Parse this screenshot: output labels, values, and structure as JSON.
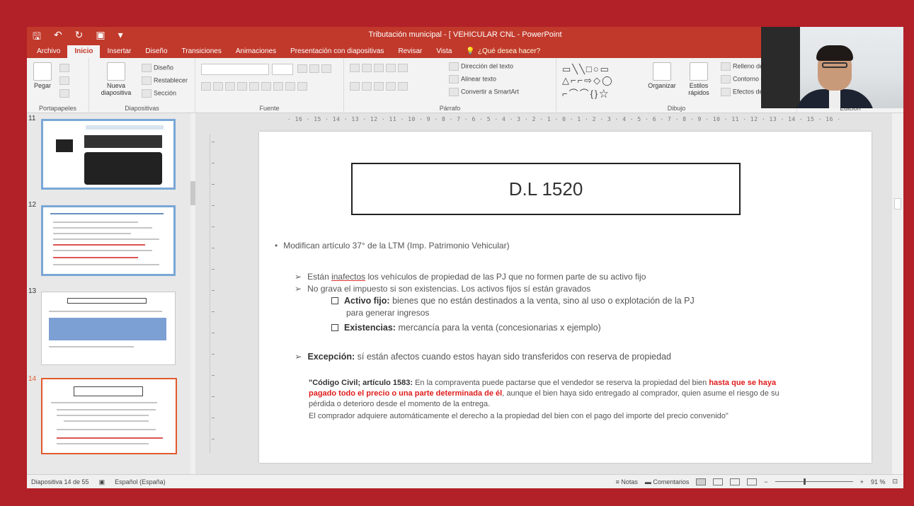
{
  "window": {
    "title": "Tributación municipal - [ VEHICULAR CNL - PowerPoint",
    "qat_icons": [
      "save-icon",
      "undo-icon",
      "redo-icon",
      "start-from-beginning-icon",
      "customize-icon"
    ]
  },
  "ribbon": {
    "tabs": [
      "Archivo",
      "Inicio",
      "Insertar",
      "Diseño",
      "Transiciones",
      "Animaciones",
      "Presentación con diapositivas",
      "Revisar",
      "Vista"
    ],
    "active_tab": "Inicio",
    "tell_me": "¿Qué desea hacer?",
    "groups": {
      "clipboard": {
        "name": "Portapapeles",
        "paste": "Pegar"
      },
      "slides": {
        "name": "Diapositivas",
        "new_slide": "Nueva diapositiva",
        "layout": "Diseño",
        "reset": "Restablecer",
        "section": "Sección"
      },
      "font": {
        "name": "Fuente"
      },
      "paragraph": {
        "name": "Párrafo",
        "text_direction": "Dirección del texto",
        "align_text": "Alinear texto",
        "convert_smartart": "Convertir a SmartArt"
      },
      "drawing": {
        "name": "Dibujo",
        "arrange": "Organizar",
        "quick_styles": "Estilos rápidos",
        "shape_fill": "Relleno de forma",
        "shape_outline": "Contorno de forma",
        "shape_effects": "Efectos de forma"
      },
      "editing": {
        "name": "Edición"
      }
    }
  },
  "thumbnails": [
    {
      "number": "11"
    },
    {
      "number": "12"
    },
    {
      "number": "13"
    },
    {
      "number": "14"
    }
  ],
  "ruler": "· 16 · 15 · 14 · 13 · 12 · 11 · 10 · 9 · 8 · 7 · 6 · 5 · 4 · 3 · 2 · 1 · 0 · 1 · 2 · 3 · 4 · 5 · 6 · 7 · 8 · 9 · 10 · 11 · 12 · 13 · 14 · 15 · 16 ·",
  "slide": {
    "title": "D.L 1520",
    "bullet_main": "Modifican artículo 37° de la LTM (Imp. Patrimonio Vehicular)",
    "sub1_pre": "Están ",
    "sub1_underlined": "inafectos",
    "sub1_post": " los vehículos de propiedad de las PJ que no formen parte de su activo fijo",
    "sub2": "No grava el impuesto si son existencias. Los activos fijos sí están gravados",
    "activo_label": "Activo fijo:",
    "activo_text": " bienes que no están destinados a la venta, sino al uso o explotación de la PJ",
    "activo_text2": "para generar ingresos",
    "exist_label": "Existencias:",
    "exist_text": " mercancía para la venta (concesionarias x ejemplo)",
    "excepcion_label": "Excepción:",
    "excepcion_text": " sí están afectos cuando estos hayan sido transferidos con reserva de propiedad",
    "cc_label": "\"Código Civil; artículo 1583:",
    "cc_text1": " En la compraventa puede pactarse que el vendedor se reserva la propiedad del bien",
    "cc_red": "hasta que se haya pagado todo el precio o una parte determinada de él",
    "cc_text2": ", aunque el bien haya sido entregado al comprador, quien asume el riesgo de su pérdida o deterioro desde el momento de la entrega.",
    "cc_text3": "El comprador adquiere automáticamente el derecho a la propiedad del bien con el pago del importe del precio convenido\""
  },
  "status": {
    "slide_count": "Diapositiva 14 de 55",
    "language": "Español (España)",
    "notes": "Notas",
    "comments": "Comentarios",
    "zoom": "91 %"
  },
  "colors": {
    "frame": "#b22028",
    "ribbon": "#c0392b",
    "emphasis_red": "#e01c1c",
    "selected_thumb": "#e05a2b"
  }
}
